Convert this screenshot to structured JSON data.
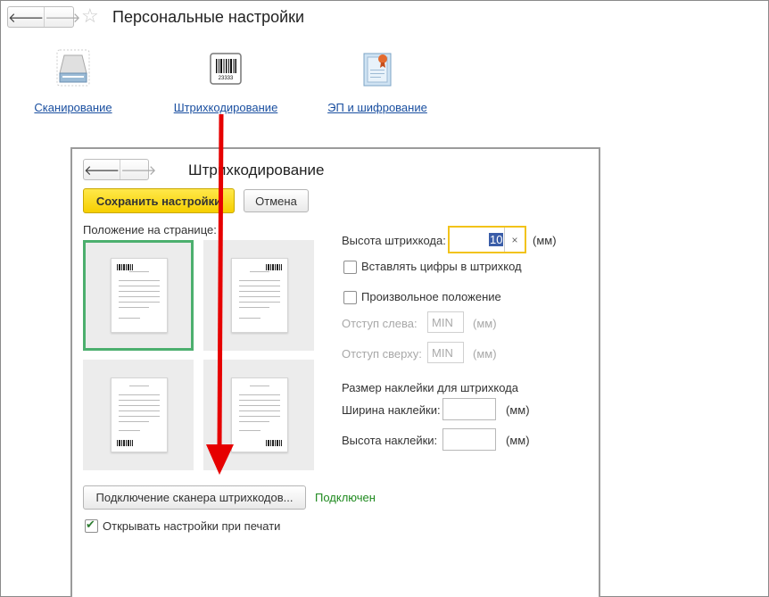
{
  "window": {
    "title": "Персональные настройки"
  },
  "tiles": [
    {
      "label": "Сканирование",
      "icon": "scanner-icon"
    },
    {
      "label": "Штрихкодирование",
      "icon": "barcode-icon"
    },
    {
      "label": "ЭП и шифрование",
      "icon": "certificate-icon"
    }
  ],
  "barcode_icon_text": "23333",
  "dialog": {
    "title": "Штрихкодирование",
    "save_label": "Сохранить настройки",
    "cancel_label": "Отмена",
    "position_label": "Положение на странице:",
    "barcode_height_label": "Высота штрихкода:",
    "barcode_height_value": "10",
    "clear_symbol": "×",
    "unit_mm": "(мм)",
    "insert_digits_label": "Вставлять цифры в штрихкод",
    "free_position_label": "Произвольное положение",
    "offset_left_label": "Отступ слева:",
    "offset_top_label": "Отступ сверху:",
    "min_placeholder": "MIN",
    "sticker_size_label": "Размер наклейки для штрихкода",
    "sticker_width_label": "Ширина наклейки:",
    "sticker_height_label": "Высота наклейки:",
    "scanner_button_label": "Подключение сканера штрихкодов...",
    "scanner_status": "Подключен",
    "open_on_print_label": "Открывать настройки при печати",
    "open_on_print_checked": true,
    "insert_digits_checked": false,
    "free_position_checked": false
  },
  "colors": {
    "accent": "#f6cf00",
    "link": "#1a4fa0",
    "selected": "#4caf6e",
    "status_ok": "#1f8a1f",
    "arrow": "#e60000"
  }
}
